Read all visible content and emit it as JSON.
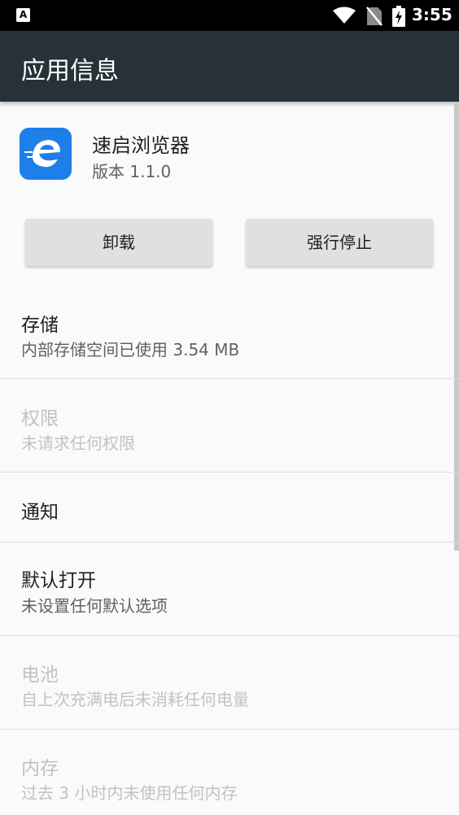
{
  "status_bar": {
    "notification_icon_letter": "A",
    "time": "3:55"
  },
  "app_bar": {
    "title": "应用信息"
  },
  "app": {
    "name": "速启浏览器",
    "version": "版本 1.1.0",
    "icon_label": "速启浏览器"
  },
  "buttons": {
    "uninstall": "卸载",
    "force_stop": "强行停止"
  },
  "preferences": [
    {
      "title": "存储",
      "summary": "内部存储空间已使用 3.54 MB",
      "enabled": true
    },
    {
      "title": "权限",
      "summary": "未请求任何权限",
      "enabled": false
    },
    {
      "title": "通知",
      "summary": "",
      "enabled": true
    },
    {
      "title": "默认打开",
      "summary": "未设置任何默认选项",
      "enabled": true
    },
    {
      "title": "电池",
      "summary": "自上次充满电后未消耗任何电量",
      "enabled": false
    },
    {
      "title": "内存",
      "summary": "过去 3 小时内未使用任何内存",
      "enabled": false
    }
  ],
  "colors": {
    "app_bar": "#263238",
    "status_bar": "#000000",
    "background": "#fafafa",
    "button": "#e0e0e0",
    "icon_blue": "#1e7fe8"
  }
}
